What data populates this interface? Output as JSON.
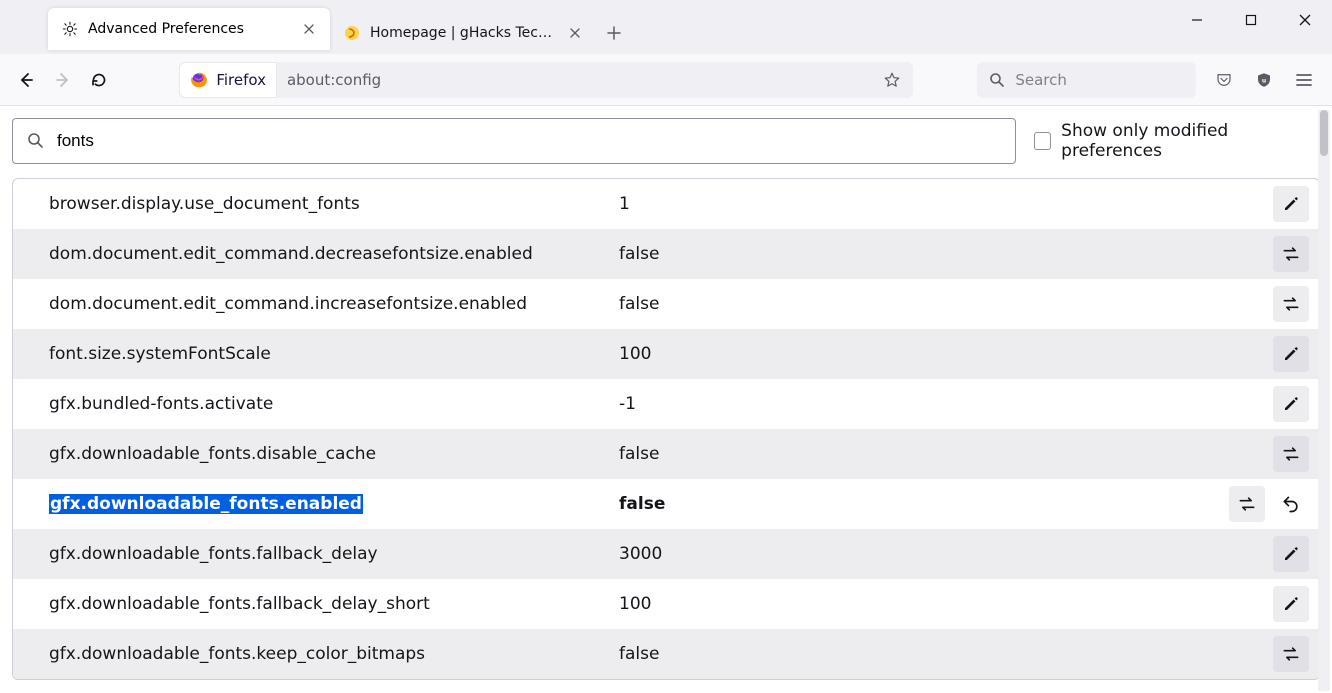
{
  "tabs": [
    {
      "title": "Advanced Preferences",
      "active": true,
      "favicon": "gear"
    },
    {
      "title": "Homepage | gHacks Technology News",
      "active": false,
      "favicon": "ghacks"
    }
  ],
  "identity_label": "Firefox",
  "url": "about:config",
  "search_placeholder": "Search",
  "filter_value": "fonts",
  "modified_checkbox_label": "Show only modified preferences",
  "prefs": [
    {
      "name": "browser.display.use_document_fonts",
      "value": "1",
      "action": "edit",
      "modified": false,
      "hl": false,
      "reset": false
    },
    {
      "name": "dom.document.edit_command.decreasefontsize.enabled",
      "value": "false",
      "action": "toggle",
      "modified": false,
      "hl": false,
      "reset": false
    },
    {
      "name": "dom.document.edit_command.increasefontsize.enabled",
      "value": "false",
      "action": "toggle",
      "modified": false,
      "hl": false,
      "reset": false
    },
    {
      "name": "font.size.systemFontScale",
      "value": "100",
      "action": "edit",
      "modified": false,
      "hl": false,
      "reset": false
    },
    {
      "name": "gfx.bundled-fonts.activate",
      "value": "-1",
      "action": "edit",
      "modified": false,
      "hl": false,
      "reset": false
    },
    {
      "name": "gfx.downloadable_fonts.disable_cache",
      "value": "false",
      "action": "toggle",
      "modified": false,
      "hl": false,
      "reset": false
    },
    {
      "name": "gfx.downloadable_fonts.enabled",
      "value": "false",
      "action": "toggle",
      "modified": true,
      "hl": true,
      "reset": true
    },
    {
      "name": "gfx.downloadable_fonts.fallback_delay",
      "value": "3000",
      "action": "edit",
      "modified": false,
      "hl": false,
      "reset": false
    },
    {
      "name": "gfx.downloadable_fonts.fallback_delay_short",
      "value": "100",
      "action": "edit",
      "modified": false,
      "hl": false,
      "reset": false
    },
    {
      "name": "gfx.downloadable_fonts.keep_color_bitmaps",
      "value": "false",
      "action": "toggle",
      "modified": false,
      "hl": false,
      "reset": false
    }
  ]
}
